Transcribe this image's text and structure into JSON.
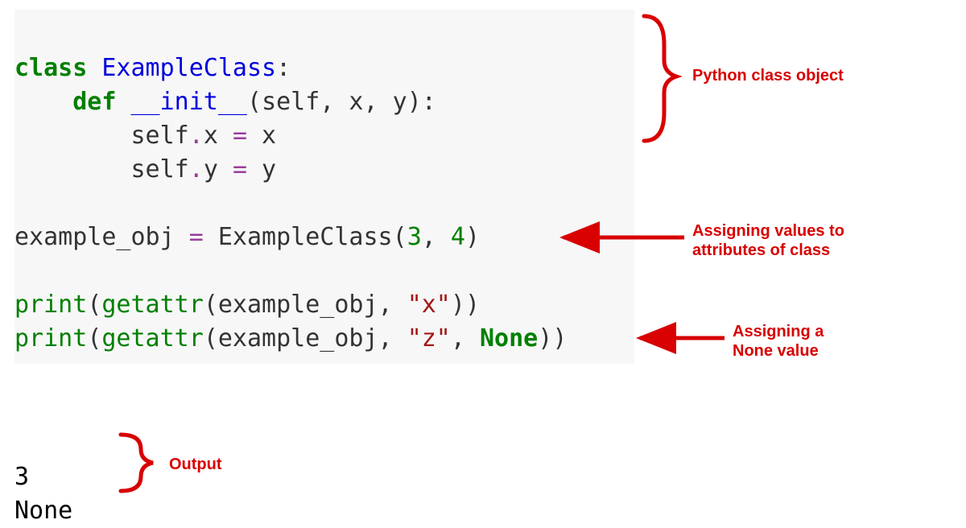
{
  "code": {
    "line1": {
      "kw": "class",
      "sp": " ",
      "name": "ExampleClass",
      "colon": ":"
    },
    "line2": {
      "indent": "    ",
      "kw": "def",
      "sp": " ",
      "fn": "__init__",
      "paren_open": "(",
      "params": "self, x, y",
      "paren_close": ")",
      "colon": ":"
    },
    "line3": {
      "indent": "        ",
      "lhs": "self",
      "dot": ".",
      "attr": "x ",
      "op": "=",
      "rhs": " x"
    },
    "line4": {
      "indent": "        ",
      "lhs": "self",
      "dot": ".",
      "attr": "y ",
      "op": "=",
      "rhs": " y"
    },
    "blank1": "",
    "line5": {
      "lhs": "example_obj ",
      "op": "=",
      "sp": " ",
      "call": "ExampleClass",
      "paren_open": "(",
      "arg1": "3",
      "comma": ", ",
      "arg2": "4",
      "paren_close": ")"
    },
    "blank2": "",
    "line6": {
      "fn": "print",
      "paren_open": "(",
      "getattr": "getattr",
      "inner_open": "(",
      "arg1": "example_obj, ",
      "str": "\"x\"",
      "inner_close": ")",
      "paren_close": ")"
    },
    "line7": {
      "fn": "print",
      "paren_open": "(",
      "getattr": "getattr",
      "inner_open": "(",
      "arg1": "example_obj, ",
      "str": "\"z\"",
      "comma": ", ",
      "none": "None",
      "inner_close": ")",
      "paren_close": ")"
    }
  },
  "output": {
    "line1": "3",
    "line2": "None"
  },
  "annotations": {
    "class_obj": "Python class object",
    "assign_attrs_l1": "Assigning values to",
    "assign_attrs_l2": "attributes of class",
    "assign_none_l1": "Assigning a",
    "assign_none_l2": "None value",
    "output": "Output"
  }
}
